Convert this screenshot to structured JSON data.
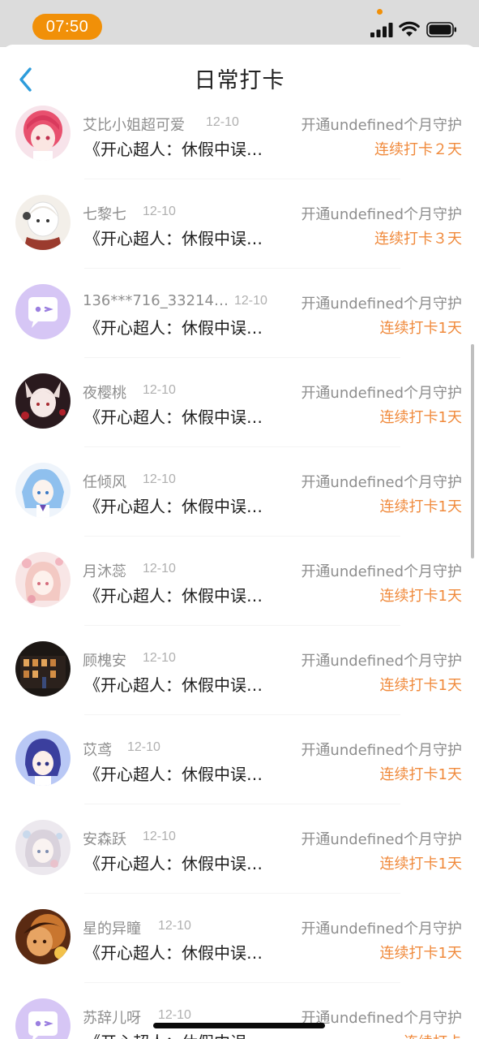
{
  "status_bar": {
    "time": "07:50",
    "signal_icon": "cellular-signal",
    "wifi_icon": "wifi",
    "battery_icon": "battery-full",
    "accent": "#f19008"
  },
  "header": {
    "title": "日常打卡",
    "back_icon": "chevron-left"
  },
  "colors": {
    "accent_blue": "#2d9cdb",
    "streak_orange": "#f08a3c",
    "meta_gray": "#8e8e8e"
  },
  "entries": [
    {
      "name": "艾比小姐超可爱",
      "date": "12-10",
      "guard": "开通undefined个月守护",
      "title": "《开心超人：休假中误…",
      "streak": "连续打卡２天",
      "avatar": "anime-girl-pink"
    },
    {
      "name": "七黎七",
      "date": "12-10",
      "guard": "开通undefined个月守护",
      "title": "《开心超人：休假中误…",
      "streak": "连续打卡３天",
      "avatar": "anime-girl-scarf"
    },
    {
      "name": "136***716_33214…",
      "date": "12-10",
      "guard": "开通undefined个月守护",
      "title": "《开心超人：休假中误…",
      "streak": "连续打卡1天",
      "avatar": "default-chat-bubble"
    },
    {
      "name": "夜樱桃",
      "date": "12-10",
      "guard": "开通undefined个月守护",
      "title": "《开心超人：休假中误…",
      "streak": "连续打卡1天",
      "avatar": "anime-fox-girl"
    },
    {
      "name": "任倾风",
      "date": "12-10",
      "guard": "开通undefined个月守护",
      "title": "《开心超人：休假中误…",
      "streak": "连续打卡1天",
      "avatar": "anime-blue-hair"
    },
    {
      "name": "月沐蕊",
      "date": "12-10",
      "guard": "开通undefined个月守护",
      "title": "《开心超人：休假中误…",
      "streak": "连续打卡1天",
      "avatar": "anime-pink-flowers"
    },
    {
      "name": "顾槐安",
      "date": "12-10",
      "guard": "开通undefined个月守护",
      "title": "《开心超人：休假中误…",
      "streak": "连续打卡1天",
      "avatar": "night-building"
    },
    {
      "name": "苡鸢",
      "date": "12-10",
      "guard": "开通undefined个月守护",
      "title": "《开心超人：休假中误…",
      "streak": "连续打卡1天",
      "avatar": "anime-purple-hair"
    },
    {
      "name": "安森跃",
      "date": "12-10",
      "guard": "开通undefined个月守护",
      "title": "《开心超人：休假中误…",
      "streak": "连续打卡1天",
      "avatar": "anime-pale-girl"
    },
    {
      "name": "星的异瞳",
      "date": "12-10",
      "guard": "开通undefined个月守护",
      "title": "《开心超人：休假中误…",
      "streak": "连续打卡1天",
      "avatar": "warm-portrait"
    },
    {
      "name": "苏辞儿呀",
      "date": "12-10",
      "guard": "开通undefined个月守护",
      "title": "《开心超人：休假中误…",
      "streak": "连续打卡",
      "avatar": "default-chat-bubble"
    }
  ]
}
